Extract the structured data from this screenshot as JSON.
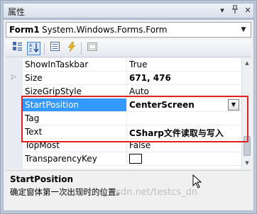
{
  "window": {
    "title": "属性"
  },
  "selector": {
    "name": "Form1",
    "type": "System.Windows.Forms.Form"
  },
  "toolbar": {
    "tools": [
      {
        "name": "categorized",
        "icon": "categorized-icon"
      },
      {
        "name": "alphabetical",
        "icon": "alphabetical-sort-icon",
        "active": true
      },
      {
        "name": "properties",
        "icon": "properties-icon"
      },
      {
        "name": "events",
        "icon": "lightning-icon"
      },
      {
        "name": "property-pages",
        "icon": "property-pages-icon"
      }
    ]
  },
  "grid": {
    "rows": [
      {
        "name": "ShowInTaskbar",
        "value": "True"
      },
      {
        "name": "Size",
        "value": "671, 476",
        "bold": true,
        "expandable": true
      },
      {
        "name": "SizeGripStyle",
        "value": "Auto"
      },
      {
        "name": "StartPosition",
        "value": "CenterScreen",
        "bold": true,
        "selected": true,
        "dropdown": true
      },
      {
        "name": "Tag",
        "value": ""
      },
      {
        "name": "Text",
        "value": "CSharp文件读取与写入",
        "bold": true
      },
      {
        "name": "TopMost",
        "value": "False"
      },
      {
        "name": "TransparencyKey",
        "value": "",
        "swatch": true
      }
    ]
  },
  "description": {
    "title": "StartPosition",
    "text": "确定窗体第一次出现时的位置。"
  },
  "watermark": "http://blog.csdn.net/testcs_dn",
  "colors": {
    "selection": "#3399ff",
    "highlight_box": "#e02020"
  }
}
